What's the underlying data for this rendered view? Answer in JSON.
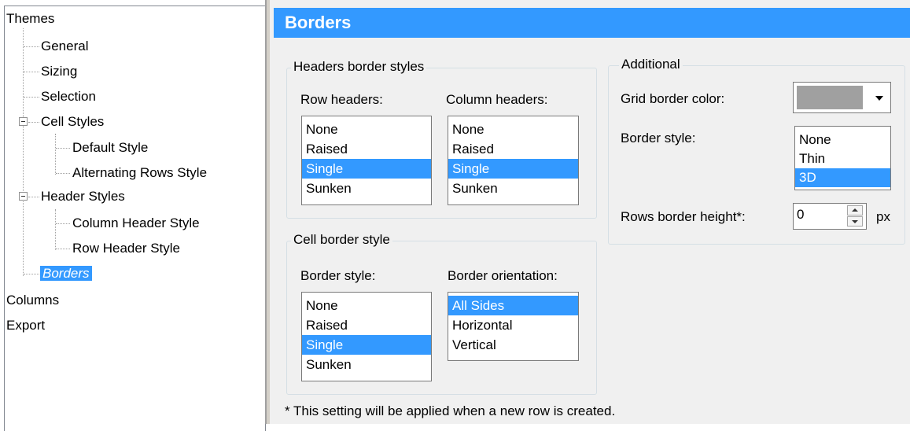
{
  "tree": {
    "items": [
      {
        "label": "Themes"
      },
      {
        "label": "General"
      },
      {
        "label": "Sizing"
      },
      {
        "label": "Selection"
      },
      {
        "label": "Cell Styles"
      },
      {
        "label": "Default Style"
      },
      {
        "label": "Alternating Rows Style"
      },
      {
        "label": "Header Styles"
      },
      {
        "label": "Column Header Style"
      },
      {
        "label": "Row Header Style"
      },
      {
        "label": "Borders"
      },
      {
        "label": "Columns"
      },
      {
        "label": "Export"
      }
    ],
    "selected": "Borders"
  },
  "panel": {
    "title": "Borders",
    "headers_group": {
      "legend": "Headers border styles",
      "row_headers": {
        "label": "Row headers:",
        "options": [
          "None",
          "Raised",
          "Single",
          "Sunken"
        ],
        "selected": "Single"
      },
      "column_headers": {
        "label": "Column headers:",
        "options": [
          "None",
          "Raised",
          "Single",
          "Sunken"
        ],
        "selected": "Single"
      }
    },
    "cell_group": {
      "legend": "Cell border style",
      "border_style": {
        "label": "Border style:",
        "options": [
          "None",
          "Raised",
          "Single",
          "Sunken"
        ],
        "selected": "Single"
      },
      "border_orientation": {
        "label": "Border orientation:",
        "options": [
          "All Sides",
          "Horizontal",
          "Vertical"
        ],
        "selected": "All Sides"
      }
    },
    "additional_group": {
      "legend": "Additional",
      "grid_color_label": "Grid border color:",
      "grid_color_value": "#a0a0a0",
      "border_style_label": "Border style:",
      "border_style_options": [
        "None",
        "Thin",
        "3D"
      ],
      "border_style_selected": "3D",
      "rows_height_label": "Rows border height*:",
      "rows_height_value": "0",
      "rows_height_unit": "px"
    },
    "footnote": "* This setting will be applied when a new row is created."
  },
  "colors": {
    "accent": "#3399ff",
    "panel_bg": "#f0f0f0",
    "group_border": "#d5dfe5"
  }
}
